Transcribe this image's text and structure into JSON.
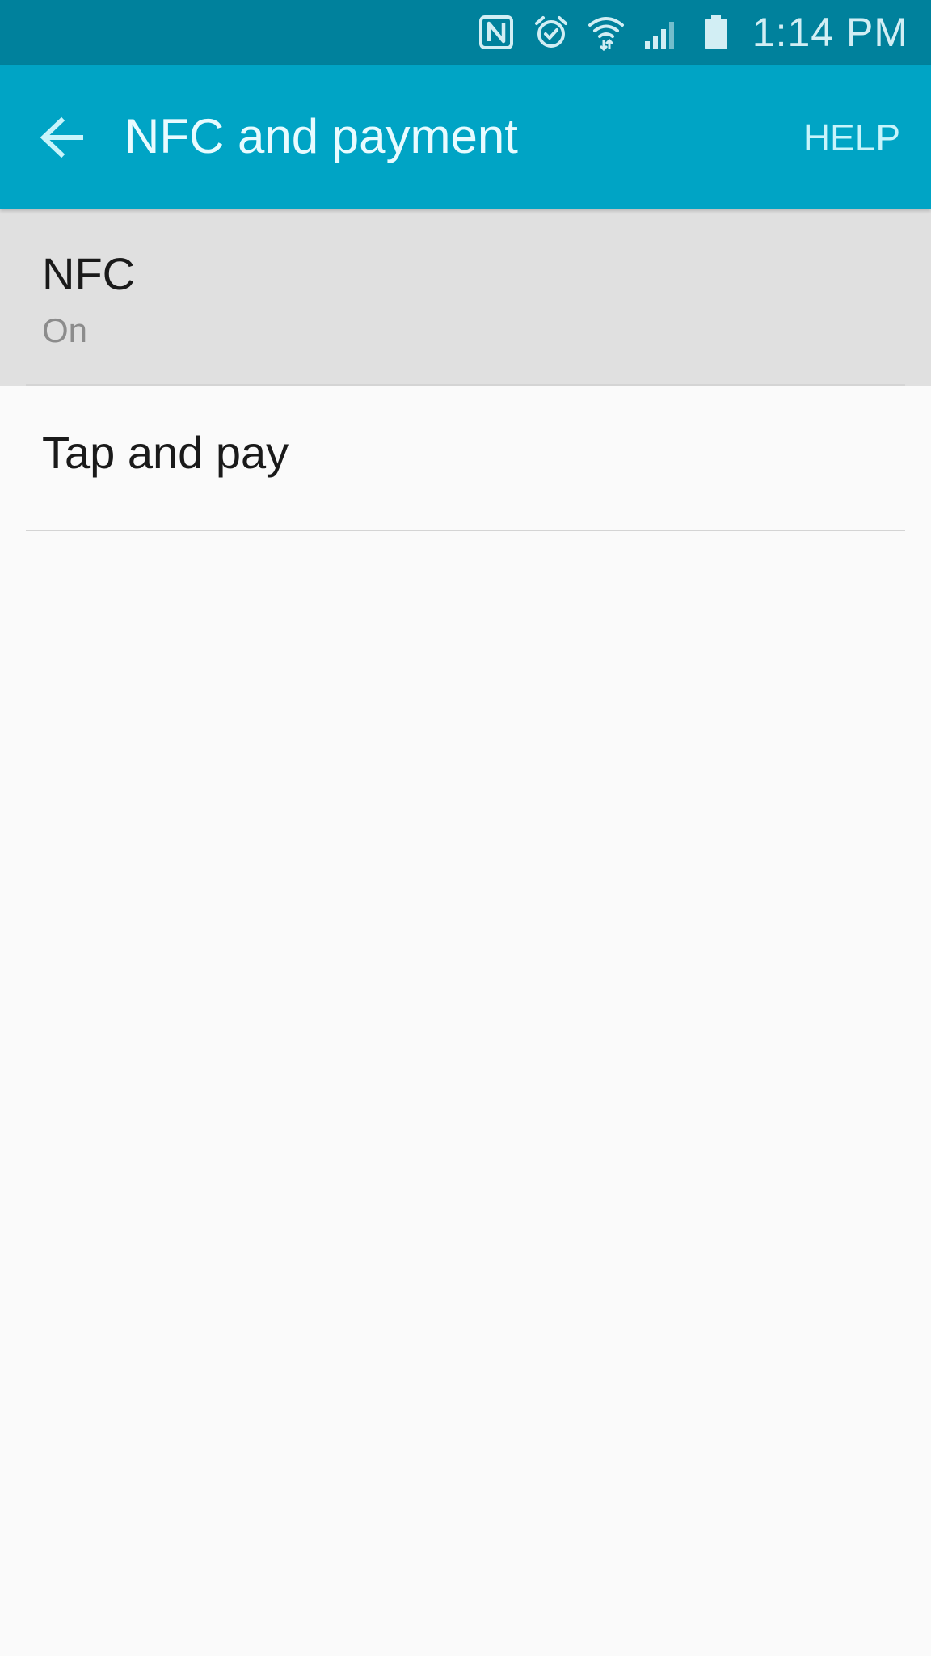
{
  "status_bar": {
    "time": "1:14 PM",
    "icons": [
      "nfc-icon",
      "alarm-icon",
      "wifi-icon",
      "signal-icon",
      "battery-icon"
    ],
    "background": "#00819c"
  },
  "action_bar": {
    "title": "NFC and payment",
    "help_label": "HELP",
    "back_icon": "back-arrow-icon",
    "background": "#00a4c5"
  },
  "settings": {
    "items": [
      {
        "title": "NFC",
        "subtitle": "On"
      },
      {
        "title": "Tap and pay"
      }
    ]
  }
}
